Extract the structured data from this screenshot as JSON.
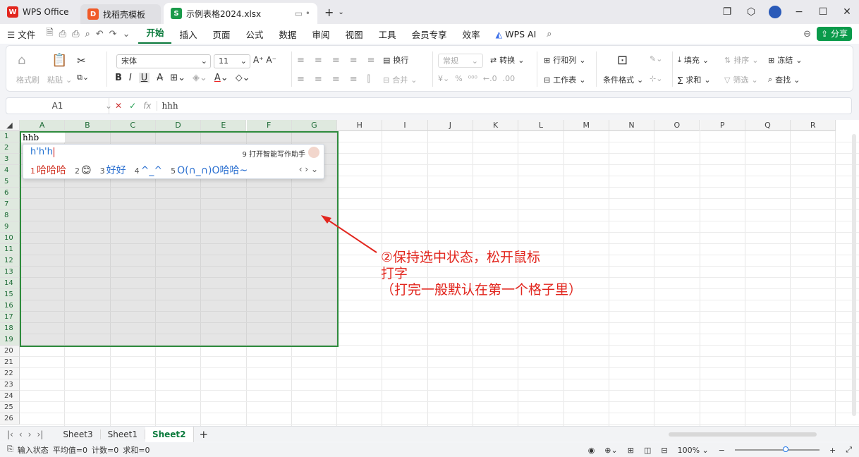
{
  "tabs": {
    "wps": "WPS Office",
    "template": "找稻壳模板",
    "file": "示例表格2024.xlsx",
    "add": "+"
  },
  "menu": {
    "file": "文件",
    "items": [
      "开始",
      "插入",
      "页面",
      "公式",
      "数据",
      "审阅",
      "视图",
      "工具",
      "会员专享",
      "效率"
    ],
    "ai": "WPS AI",
    "share": "分享"
  },
  "ribbon": {
    "format_painter": "格式刷",
    "paste": "粘贴",
    "font": "宋体",
    "size": "11",
    "wrap": "换行",
    "number_format": "常规",
    "convert": "转换",
    "rows_cols": "行和列",
    "merge": "合并",
    "worksheet": "工作表",
    "cond_format": "条件格式",
    "fill": "填充",
    "sort": "排序",
    "freeze": "冻结",
    "sum": "求和",
    "filter": "筛选",
    "find": "查找"
  },
  "formula": {
    "cell_ref": "A1",
    "content": "hhh"
  },
  "columns": [
    "A",
    "B",
    "C",
    "D",
    "E",
    "F",
    "G",
    "H",
    "I",
    "J",
    "K",
    "L",
    "M",
    "N",
    "O",
    "P",
    "Q",
    "R"
  ],
  "rows": [
    "1",
    "2",
    "3",
    "4",
    "5",
    "6",
    "7",
    "8",
    "9",
    "10",
    "11",
    "12",
    "13",
    "14",
    "15",
    "16",
    "17",
    "18",
    "19",
    "20",
    "21",
    "22",
    "23",
    "24",
    "25",
    "26"
  ],
  "cell_a1": "hhb",
  "ime": {
    "composition": "h'h'h",
    "assist": "9 打开智能写作助手",
    "candidates": [
      {
        "n": "1",
        "text": "哈哈哈"
      },
      {
        "n": "2",
        "text": "😊"
      },
      {
        "n": "3",
        "text": "好好"
      },
      {
        "n": "4",
        "text": "^_^"
      },
      {
        "n": "5",
        "text": "O(∩_∩)O哈哈~"
      }
    ]
  },
  "annotation": {
    "line1": "②保持选中状态，松开鼠标",
    "line2": "打字",
    "line3": "（打完一般默认在第一个格子里）"
  },
  "sheets": [
    "Sheet3",
    "Sheet1",
    "Sheet2"
  ],
  "active_sheet": "Sheet2",
  "status": {
    "input_state": "输入状态",
    "avg": "平均值=0",
    "count": "计数=0",
    "sum": "求和=0",
    "zoom": "100%"
  },
  "colors": {
    "accent": "#0a7a3c",
    "selection_border": "#2e8b3d",
    "annotation": "#e2261e"
  }
}
